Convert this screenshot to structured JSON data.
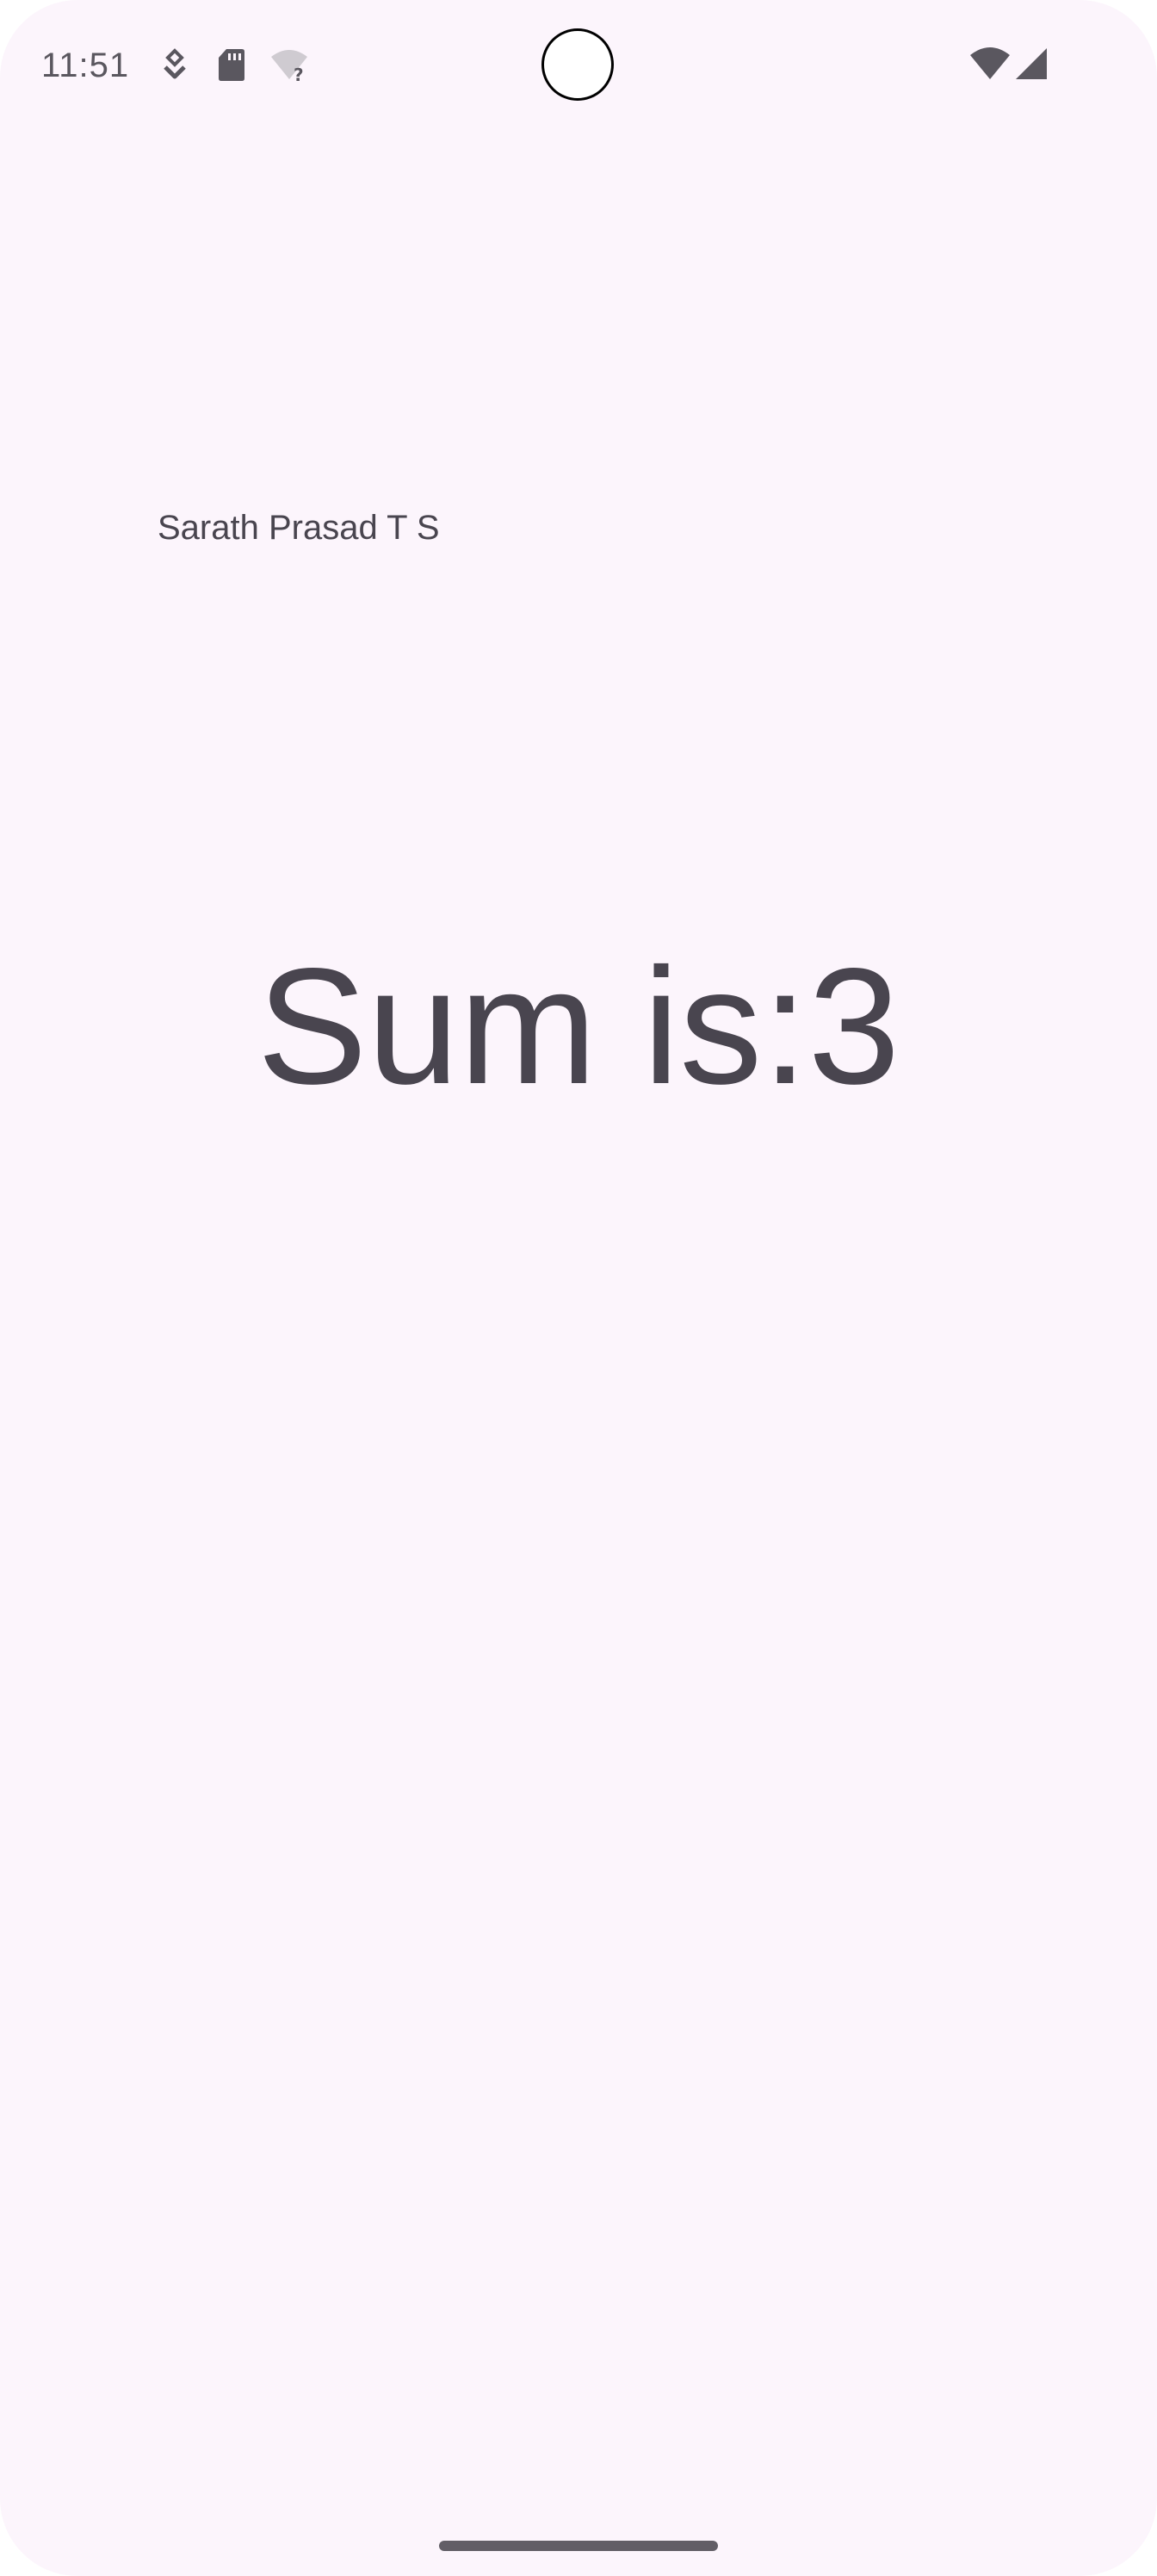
{
  "status_bar": {
    "time": "11:51",
    "icons": {
      "left": [
        "notification-badge-icon",
        "sd-card-icon",
        "wifi-unknown-icon"
      ],
      "right": [
        "wifi-icon",
        "cell-signal-icon"
      ]
    }
  },
  "main": {
    "author_name": "Sarath Prasad T S",
    "sum_text": "Sum is:3"
  },
  "colors": {
    "background": "#fcf5fc",
    "text": "#49454f",
    "status_text": "#5a575f"
  }
}
